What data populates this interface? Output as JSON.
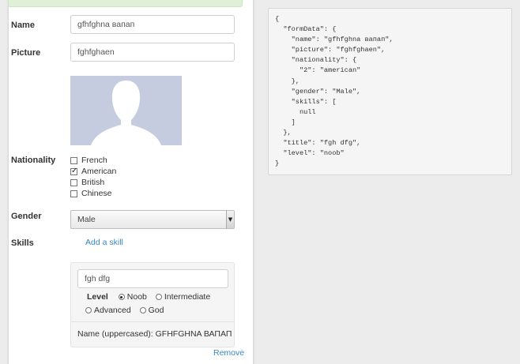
{
  "form": {
    "name": {
      "label": "Name",
      "value": "gfhfghna вапап"
    },
    "picture": {
      "label": "Picture",
      "value": "fghfghaen"
    },
    "avatar": {
      "icon": "user-silhouette-icon"
    },
    "nationality": {
      "label": "Nationality",
      "options": [
        {
          "label": "French",
          "checked": false
        },
        {
          "label": "American",
          "checked": true
        },
        {
          "label": "British",
          "checked": false
        },
        {
          "label": "Chinese",
          "checked": false
        }
      ]
    },
    "gender": {
      "label": "Gender",
      "value": "Male"
    },
    "skills": {
      "label": "Skills",
      "add_label": "Add a skill",
      "item": {
        "title": "fgh dfg",
        "level_label": "Level",
        "levels": [
          {
            "label": "Noob",
            "checked": true
          },
          {
            "label": "Intermediate",
            "checked": false
          },
          {
            "label": "Advanced",
            "checked": false
          },
          {
            "label": "God",
            "checked": false
          }
        ],
        "uppercased": "Name (uppercased): GFHFGHNA ВАПАП",
        "remove_label": "Remove"
      }
    }
  },
  "json_output": "{\n  \"formData\": {\n    \"name\": \"gfhfghna вапап\",\n    \"picture\": \"fghfghaen\",\n    \"nationality\": {\n      \"2\": \"american\"\n    },\n    \"gender\": \"Male\",\n    \"skills\": [\n      null\n    ]\n  },\n  \"title\": \"fgh dfg\",\n  \"level\": \"noob\"\n}",
  "colors": {
    "link": "#3a87c0",
    "success_alert": "#dff0d8",
    "avatar_bg": "#c5cce0"
  }
}
